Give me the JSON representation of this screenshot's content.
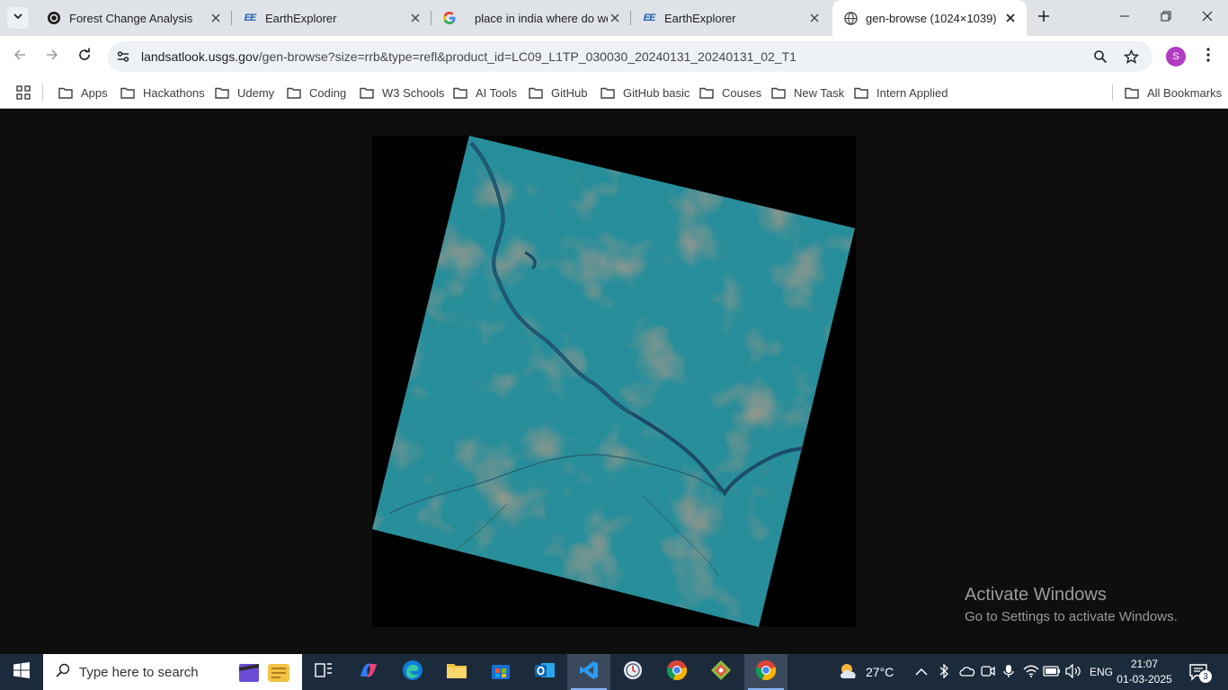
{
  "tabs": [
    {
      "title": "Forest Change Analysis",
      "icon": "openai-icon",
      "active": false
    },
    {
      "title": "EarthExplorer",
      "icon": "ee-icon",
      "favicon_text": "EE",
      "active": false
    },
    {
      "title": "place in india where do we h",
      "icon": "google-icon",
      "active": false
    },
    {
      "title": "EarthExplorer",
      "icon": "ee-icon",
      "favicon_text": "EE",
      "active": false
    },
    {
      "title": "gen-browse (1024×1039)",
      "icon": "globe-icon",
      "active": true
    }
  ],
  "address": {
    "host": "landsatlook.usgs.gov",
    "path": "/gen-browse?size=rrb&type=refl&product_id=LC09_L1TP_030030_20240131_20240131_02_T1"
  },
  "profile": {
    "initial": "S",
    "color": "#b23cc2"
  },
  "bookmarks": [
    {
      "label": "Apps"
    },
    {
      "label": "Hackathons"
    },
    {
      "label": "Udemy"
    },
    {
      "label": "Coding"
    },
    {
      "label": "W3 Schools"
    },
    {
      "label": "AI Tools"
    },
    {
      "label": "GitHub"
    },
    {
      "label": "GitHub basic"
    },
    {
      "label": "Couses"
    },
    {
      "label": "New Task"
    },
    {
      "label": "Intern Applied"
    }
  ],
  "all_bookmarks": "All Bookmarks",
  "watermark": {
    "line1": "Activate Windows",
    "line2": "Go to Settings to activate Windows."
  },
  "taskbar": {
    "search_placeholder": "Type here to search",
    "weather": "27°C",
    "language": "ENG",
    "time": "21:07",
    "date": "01-03-2025",
    "notifications": "3"
  },
  "colors": {
    "page_background": "#0e0e0e",
    "scene_teal": "#1f8e9c",
    "river": "#1b4a66",
    "taskbar": "#1c2b3c"
  }
}
